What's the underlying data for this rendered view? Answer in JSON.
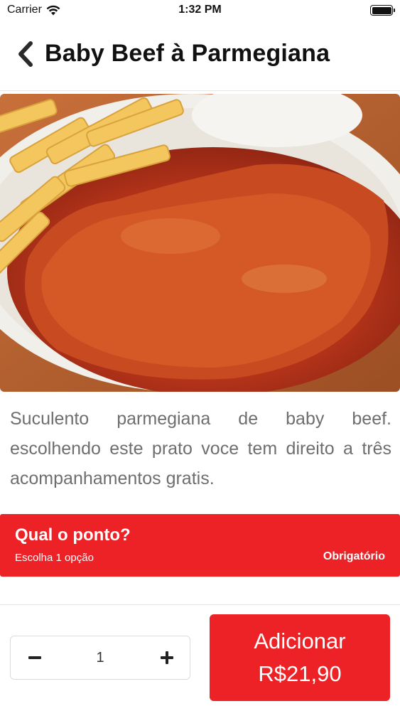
{
  "status_bar": {
    "carrier": "Carrier",
    "time": "1:32 PM"
  },
  "nav": {
    "title": "Baby Beef à Parmegiana",
    "back_icon": "chevron-left-icon"
  },
  "product": {
    "image_alt": "Baby beef à parmegiana com batata frita e arroz",
    "description": "Suculento parmegiana de baby beef. escolhendo este prato voce tem direito a três acompanhamentos gratis."
  },
  "option_group": {
    "title": "Qual o ponto?",
    "subtitle": "Escolha 1 opção",
    "required": "Obrigatório"
  },
  "cart": {
    "quantity": "1",
    "add_label": "Adicionar",
    "price": "R$21,90"
  },
  "colors": {
    "accent": "#ec2227",
    "text_muted": "#6e6e6e"
  }
}
